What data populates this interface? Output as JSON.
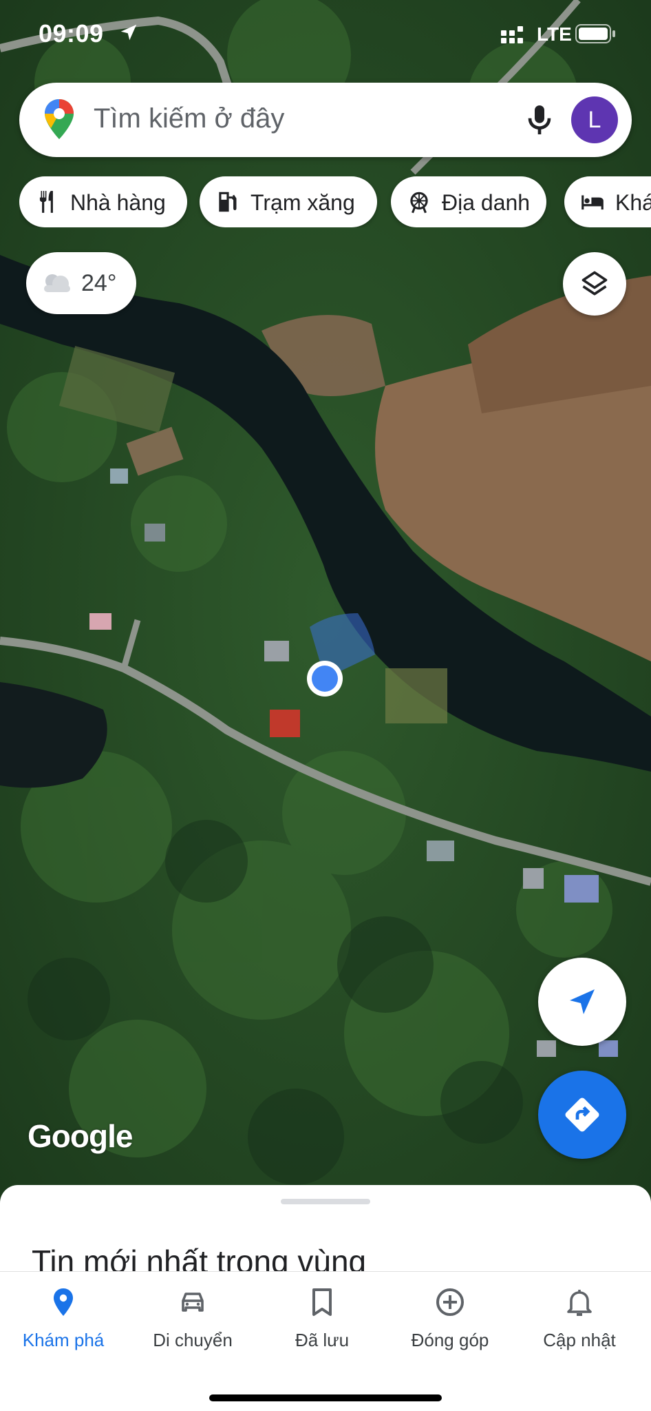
{
  "status_bar": {
    "time": "09:09",
    "network": "LTE"
  },
  "search": {
    "placeholder": "Tìm kiếm ở đây",
    "avatar_initial": "L"
  },
  "chips": [
    {
      "label": "Nhà hàng",
      "icon": "restaurant-icon"
    },
    {
      "label": "Trạm xăng",
      "icon": "gas-station-icon"
    },
    {
      "label": "Địa danh",
      "icon": "landmark-icon"
    },
    {
      "label": "Khá",
      "icon": "hotel-icon"
    }
  ],
  "weather": {
    "temperature": "24°",
    "icon": "cloud-icon"
  },
  "map": {
    "attribution": "Google",
    "view": "satellite"
  },
  "sheet": {
    "title": "Tin mới nhất trong vùng"
  },
  "bottom_nav": [
    {
      "label": "Khám phá",
      "icon": "explore-pin-icon",
      "active": true
    },
    {
      "label": "Di chuyển",
      "icon": "car-icon",
      "active": false
    },
    {
      "label": "Đã lưu",
      "icon": "bookmark-icon",
      "active": false
    },
    {
      "label": "Đóng góp",
      "icon": "add-circle-icon",
      "active": false
    },
    {
      "label": "Cập nhật",
      "icon": "bell-icon",
      "active": false
    }
  ],
  "colors": {
    "accent": "#1a73e8",
    "avatar": "#5e35b1"
  }
}
